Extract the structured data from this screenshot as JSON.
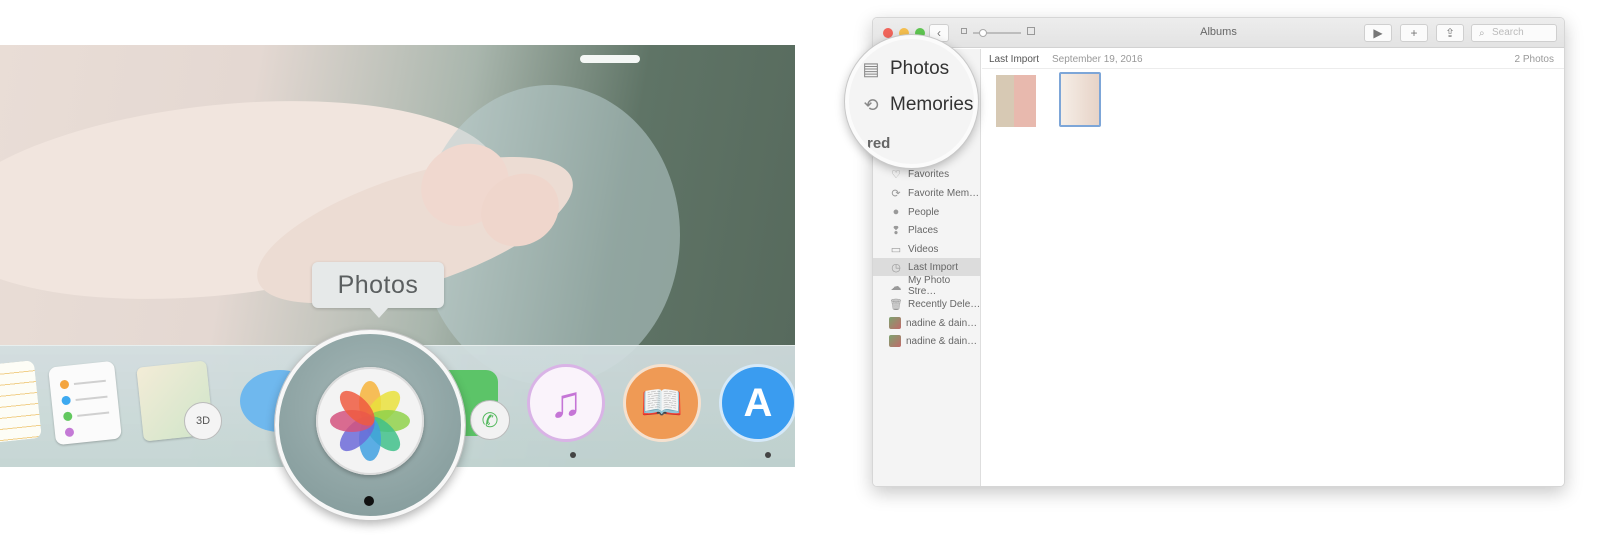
{
  "dock": {
    "tooltip_label": "Photos",
    "maps_badge": "3D",
    "apps": [
      "pages",
      "reminders",
      "maps",
      "messages",
      "photos",
      "facetime",
      "music",
      "ibooks",
      "app-store"
    ]
  },
  "window": {
    "title": "Albums",
    "search_placeholder": "Search",
    "buttons": {
      "play": "▶",
      "add": "+",
      "share": "⇪"
    }
  },
  "magnifier": {
    "items": [
      {
        "icon": "photos-icon",
        "label": "Photos"
      },
      {
        "icon": "memories-icon",
        "label": "Memories"
      }
    ],
    "section_partial": "red"
  },
  "sidebar": {
    "items": [
      {
        "icon": "heart-icon",
        "label": "Favorites"
      },
      {
        "icon": "memories-icon",
        "label": "Favorite Mem…"
      },
      {
        "icon": "person-icon",
        "label": "People"
      },
      {
        "icon": "pin-icon",
        "label": "Places"
      },
      {
        "icon": "video-icon",
        "label": "Videos"
      },
      {
        "icon": "clock-icon",
        "label": "Last Import",
        "selected": true
      },
      {
        "icon": "cloud-icon",
        "label": "My Photo Stre…"
      },
      {
        "icon": "trash-icon",
        "label": "Recently Dele…"
      },
      {
        "icon": "album-thumb",
        "label": "nadine & dain…"
      },
      {
        "icon": "album-thumb",
        "label": "nadine & dain…"
      }
    ]
  },
  "content": {
    "title": "Last Import",
    "date": "September 19, 2016",
    "count": "2 Photos"
  }
}
